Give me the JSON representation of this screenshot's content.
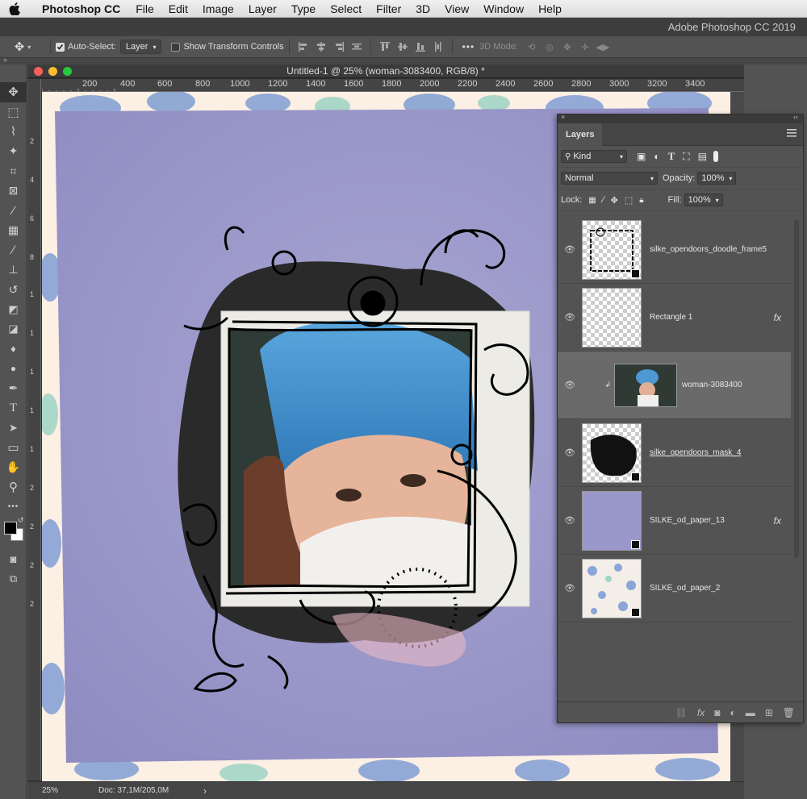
{
  "menubar": {
    "app_name": "Photoshop CC",
    "items": [
      "File",
      "Edit",
      "Image",
      "Layer",
      "Type",
      "Select",
      "Filter",
      "3D",
      "View",
      "Window",
      "Help"
    ]
  },
  "app_title": "Adobe Photoshop CC 2019",
  "options_bar": {
    "auto_select_label": "Auto-Select:",
    "auto_select_checked": true,
    "auto_select_target": "Layer",
    "show_transform_label": "Show Transform Controls",
    "show_transform_checked": false,
    "more_label": "•••",
    "mode_3d_label": "3D Mode:"
  },
  "document": {
    "title": "Untitled-1 @ 25% (woman-3083400, RGB/8) *",
    "ruler_ticks": [
      "200",
      "400",
      "600",
      "800",
      "1000",
      "1200",
      "1400",
      "1600",
      "1800",
      "2000",
      "2200",
      "2400",
      "2600",
      "2800",
      "3000",
      "3200",
      "3400"
    ],
    "ruler_v_ticks": [
      "2",
      "4",
      "6",
      "8",
      "1",
      "1",
      "1",
      "1",
      "1",
      "2",
      "2",
      "2",
      "2"
    ],
    "zoom": "25%",
    "doc_info": "Doc: 37,1M/205,0M",
    "status_arrow": "›"
  },
  "tools": [
    {
      "name": "move-tool",
      "glyph": "✥"
    },
    {
      "name": "marquee-tool",
      "glyph": "⬚"
    },
    {
      "name": "lasso-tool",
      "glyph": "⌇"
    },
    {
      "name": "magic-wand-tool",
      "glyph": "✦"
    },
    {
      "name": "crop-tool",
      "glyph": "⌗"
    },
    {
      "name": "frame-tool",
      "glyph": "⊠"
    },
    {
      "name": "eyedropper-tool",
      "glyph": "⁄"
    },
    {
      "name": "healing-brush-tool",
      "glyph": "▦"
    },
    {
      "name": "brush-tool",
      "glyph": "∕"
    },
    {
      "name": "clone-stamp-tool",
      "glyph": "⊥"
    },
    {
      "name": "history-brush-tool",
      "glyph": "↺"
    },
    {
      "name": "eraser-tool",
      "glyph": "◩"
    },
    {
      "name": "paint-bucket-tool",
      "glyph": "◪"
    },
    {
      "name": "blur-tool",
      "glyph": "♦"
    },
    {
      "name": "dodge-tool",
      "glyph": "●"
    },
    {
      "name": "pen-tool",
      "glyph": "✒"
    },
    {
      "name": "type-tool",
      "glyph": "T"
    },
    {
      "name": "path-selection-tool",
      "glyph": "➤"
    },
    {
      "name": "rectangle-tool",
      "glyph": "▭"
    },
    {
      "name": "hand-tool",
      "glyph": "✋"
    },
    {
      "name": "zoom-tool",
      "glyph": "⚲"
    },
    {
      "name": "more-tools",
      "glyph": "•••"
    }
  ],
  "layers_panel": {
    "tab": "Layers",
    "filter_kind": "Kind",
    "blend_mode": "Normal",
    "opacity_label": "Opacity:",
    "opacity_value": "100%",
    "lock_label": "Lock:",
    "fill_label": "Fill:",
    "fill_value": "100%",
    "layers": [
      {
        "name": "silke_opendoors_doodle_frame5",
        "fx": ""
      },
      {
        "name": "Rectangle 1",
        "fx": "fx"
      },
      {
        "name": "woman-3083400",
        "fx": ""
      },
      {
        "name": "silke_opendoors_mask_4",
        "fx": ""
      },
      {
        "name": "SILKE_od_paper_13",
        "fx": "fx"
      },
      {
        "name": "SILKE_od_paper_2",
        "fx": ""
      }
    ]
  }
}
